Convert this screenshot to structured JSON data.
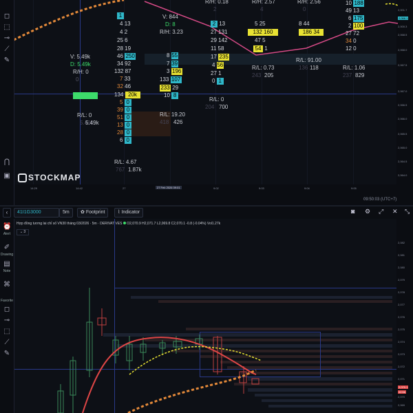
{
  "top_chart": {
    "brand": "STOCKMAP",
    "x_labels": [
      "14:29",
      "14:42",
      "27",
      "27 Feb 2026 09:01",
      "9:02",
      "9:03",
      "9:04",
      "9:05"
    ],
    "y_labels": [
      "2,001.7",
      "2,000.3",
      "2,068.5",
      "2,068.0",
      "2,067.5",
      "2,067.0",
      "2,066.5",
      "2,066.0",
      "2,065.5",
      "2,065.0",
      "2,064.5",
      "2,064.0"
    ],
    "price_tag": "2,066.1",
    "clock": "09:50:03 (UTC+7)",
    "stats": {
      "v": "V: 5.49k",
      "d": "D: 5.49k",
      "rh1": "R/H: 0",
      "rh1v": "0",
      "rl1": "R/L: 0",
      "rl1v": "5.49k",
      "rl1b": "5.49k",
      "rl2": "R/L: 4.67",
      "rl2v": "1.87k",
      "rl2a": "767",
      "v2": "V: 844",
      "d2": "D: 8",
      "rh2": "R/H: 3.23",
      "rl3": "R/L: 19.20",
      "rl3a": "418",
      "rl3b": "426",
      "rh3": "R/H: 0.18",
      "rh3b": "2",
      "rl4": "R/L: 0",
      "rl4a": "204",
      "rl4b": "700",
      "rh4": "R/H: 2.57",
      "rh4b": "4",
      "rl5": "R/L: 0.73",
      "rl5a": "243",
      "rl5b": "205",
      "rh5": "R/H: 2.56",
      "rh5b": "0",
      "rl6": "R/L: 91.00",
      "rl6a": "136",
      "rl6b": "118",
      "rl7": "R/L: 1.06",
      "rl7a": "237",
      "rl7b": "829"
    },
    "fp1": [
      [
        "",
        "1",
        "w",
        ""
      ],
      [
        "4",
        "13",
        "w",
        ""
      ],
      [
        "4",
        "2",
        "w",
        ""
      ],
      [
        "25",
        "6",
        "w",
        ""
      ],
      [
        "28",
        "19",
        "w",
        ""
      ],
      [
        "46",
        "250",
        "w",
        "c"
      ],
      [
        "34",
        "92",
        "w",
        ""
      ],
      [
        "132",
        "87",
        "w",
        ""
      ],
      [
        "7",
        "33",
        "o",
        ""
      ],
      [
        "32",
        "46",
        "o",
        ""
      ],
      [
        "134",
        "20k",
        "w",
        "g"
      ],
      [
        "5",
        "0",
        "o",
        ""
      ],
      [
        "39",
        "0",
        "o",
        ""
      ],
      [
        "51",
        "0",
        "o",
        ""
      ],
      [
        "13",
        "0",
        "o",
        ""
      ],
      [
        "28",
        "0",
        "o",
        ""
      ],
      [
        "6",
        "0",
        "w",
        ""
      ]
    ],
    "fp2": [
      [
        "8",
        "55",
        "w",
        "c"
      ],
      [
        "7",
        "39",
        "w",
        "c"
      ],
      [
        "3",
        "196",
        "w",
        "y"
      ],
      [
        "133",
        "107",
        "w",
        "c"
      ],
      [
        "233",
        "29",
        "w",
        "y"
      ],
      [
        "10",
        "8",
        "w",
        ""
      ]
    ],
    "fp3": [
      [
        "2",
        "13",
        "w",
        "c"
      ],
      [
        "27",
        "131",
        "w",
        ""
      ],
      [
        "29",
        "142",
        "w",
        ""
      ],
      [
        "11",
        "58",
        "w",
        ""
      ],
      [
        "17",
        "235",
        "w",
        "y"
      ],
      [
        "4",
        "56",
        "w",
        ""
      ],
      [
        "27",
        "1",
        "w",
        ""
      ],
      [
        "0",
        "1",
        "w",
        ""
      ]
    ],
    "fp4": [
      [
        "5",
        "25",
        "w",
        ""
      ],
      [
        "132",
        "160",
        "w",
        "y"
      ],
      [
        "47",
        "5",
        "w",
        ""
      ],
      [
        "54",
        "1",
        "w",
        "y"
      ]
    ],
    "fp5": [
      [
        "8",
        "44",
        "w",
        ""
      ],
      [
        "186",
        "34",
        "w",
        "y"
      ]
    ],
    "fp6": [
      [
        "10",
        "188",
        "w",
        "c"
      ],
      [
        "49",
        "13",
        "w",
        ""
      ],
      [
        "6",
        "175",
        "w",
        "c"
      ],
      [
        "2",
        "100",
        "w",
        "y"
      ],
      [
        "27",
        "72",
        "w",
        ""
      ],
      [
        "34",
        "0",
        "o",
        ""
      ],
      [
        "12",
        "0",
        "w",
        ""
      ]
    ]
  },
  "toolbar": {
    "symbol": "41I1G3000",
    "interval": "5m",
    "footprint": "Footprint",
    "indicator": "Indicator"
  },
  "bottom_chart": {
    "title": "Hợp đồng tương lai chỉ số VN30 tháng 03/2026 · 5m · DERIVATIVES",
    "ohlc": "O2,070.9 H2,071.7 L2,069.8 C2,070.1 -0.8 (-0.04%) Vol1.27k",
    "collapse": "3",
    "y_labels": [
      "2,082",
      "2,081",
      "2,080",
      "2,079",
      "2,078",
      "2,077",
      "2,076",
      "2,075",
      "2,074",
      "2,073",
      "2,072",
      "2,071",
      "2,070",
      "2,069",
      "2,068",
      "2,067"
    ],
    "price_tag": "2,070.1",
    "price_tag2": "02:56",
    "price_tag3": "2,069.3"
  },
  "left_toolbar": {
    "alert": "Alert",
    "drawing": "Drawing",
    "note": "Note",
    "favorite": "Favorite"
  },
  "colors": {
    "accent": "#2fb7c9",
    "yellow": "#e8e233",
    "green": "#3ddc6b",
    "orange": "#e58a3a",
    "red": "#e04646",
    "pink": "#d64a86"
  }
}
